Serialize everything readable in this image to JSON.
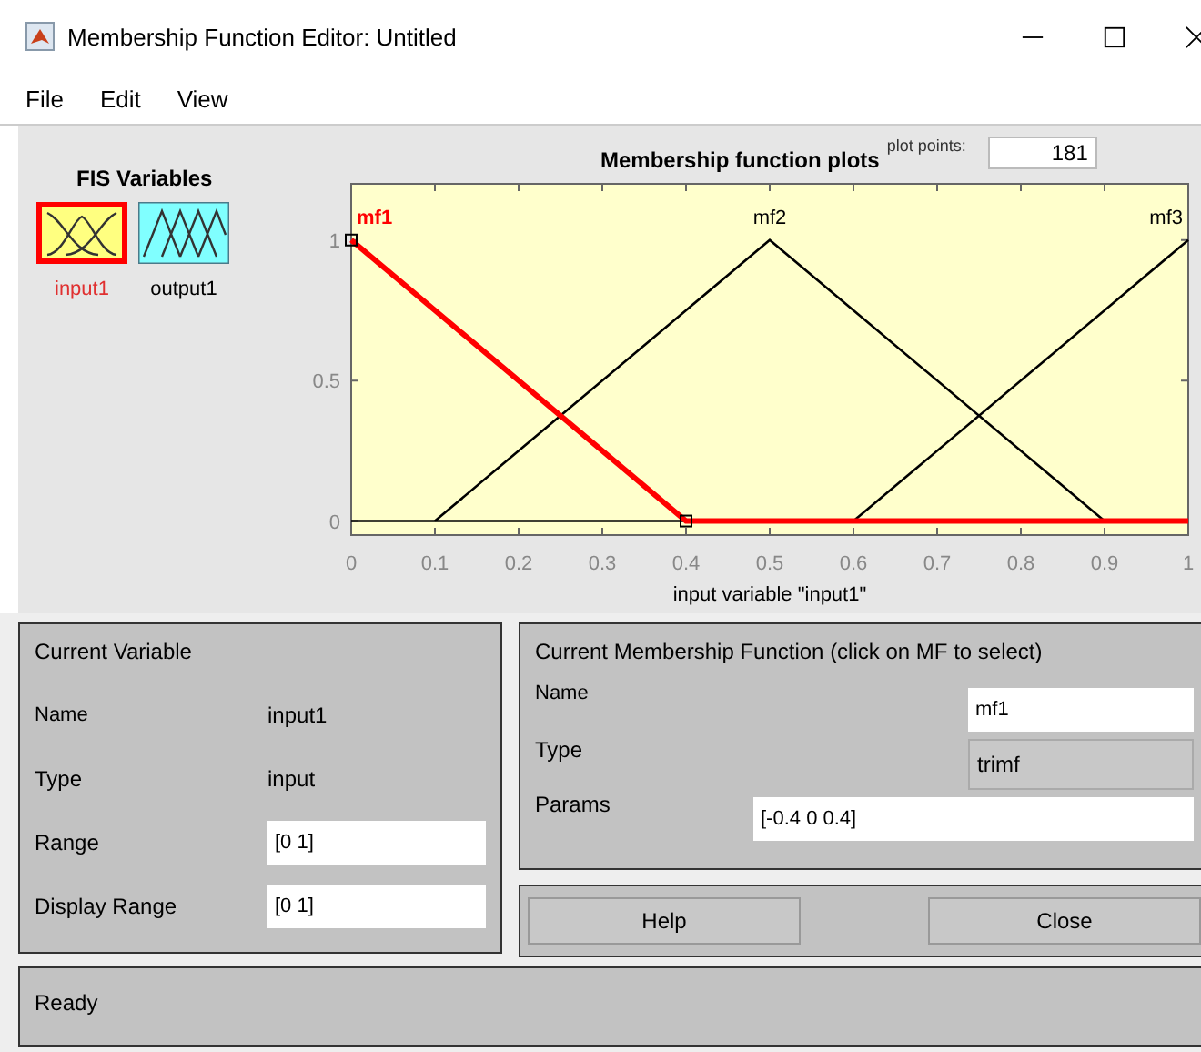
{
  "window": {
    "title": "Membership Function Editor: Untitled"
  },
  "menu": [
    "File",
    "Edit",
    "View"
  ],
  "fis_variables": {
    "title": "FIS Variables",
    "items": [
      {
        "label": "input1",
        "kind": "input",
        "selected": true
      },
      {
        "label": "output1",
        "kind": "output",
        "selected": false
      }
    ]
  },
  "plot": {
    "plot_points_label": "plot points:",
    "plot_points": "181",
    "chart_data": {
      "type": "line",
      "title": "Membership function plots",
      "xlabel": "input variable \"input1\"",
      "x": [
        0,
        0.1,
        0.4,
        0.5,
        0.6,
        0.9,
        1
      ],
      "series": [
        {
          "name": "mf1",
          "color": "#ff0000",
          "values": [
            1,
            0.75,
            0,
            0,
            0,
            0,
            0
          ]
        },
        {
          "name": "mf2",
          "color": "#000000",
          "values": [
            null,
            0,
            0.75,
            1,
            0.75,
            0,
            null
          ]
        },
        {
          "name": "mf3",
          "color": "#000000",
          "values": [
            null,
            null,
            null,
            null,
            0,
            0.75,
            1
          ]
        }
      ],
      "xlim": [
        0,
        1
      ],
      "ylim": [
        -0.05,
        1.2
      ],
      "xticks": [
        0,
        0.1,
        0.2,
        0.3,
        0.4,
        0.5,
        0.6,
        0.7,
        0.8,
        0.9,
        1
      ],
      "yticks": [
        0,
        0.5,
        1
      ]
    },
    "curve_selected": [
      true,
      false,
      false
    ]
  },
  "current_variable": {
    "title": "Current Variable",
    "name_label": "Name",
    "name": "input1",
    "type_label": "Type",
    "type": "input",
    "range_label": "Range",
    "range": "[0 1]",
    "display_range_label": "Display Range",
    "display_range": "[0 1]"
  },
  "current_mf": {
    "title": "Current Membership Function (click on MF to select)",
    "name_label": "Name",
    "name": "mf1",
    "type_label": "Type",
    "type": "trimf",
    "params_label": "Params",
    "params": "[-0.4 0 0.4]"
  },
  "buttons": [
    "Help",
    "Close"
  ],
  "status_bar": "Ready"
}
